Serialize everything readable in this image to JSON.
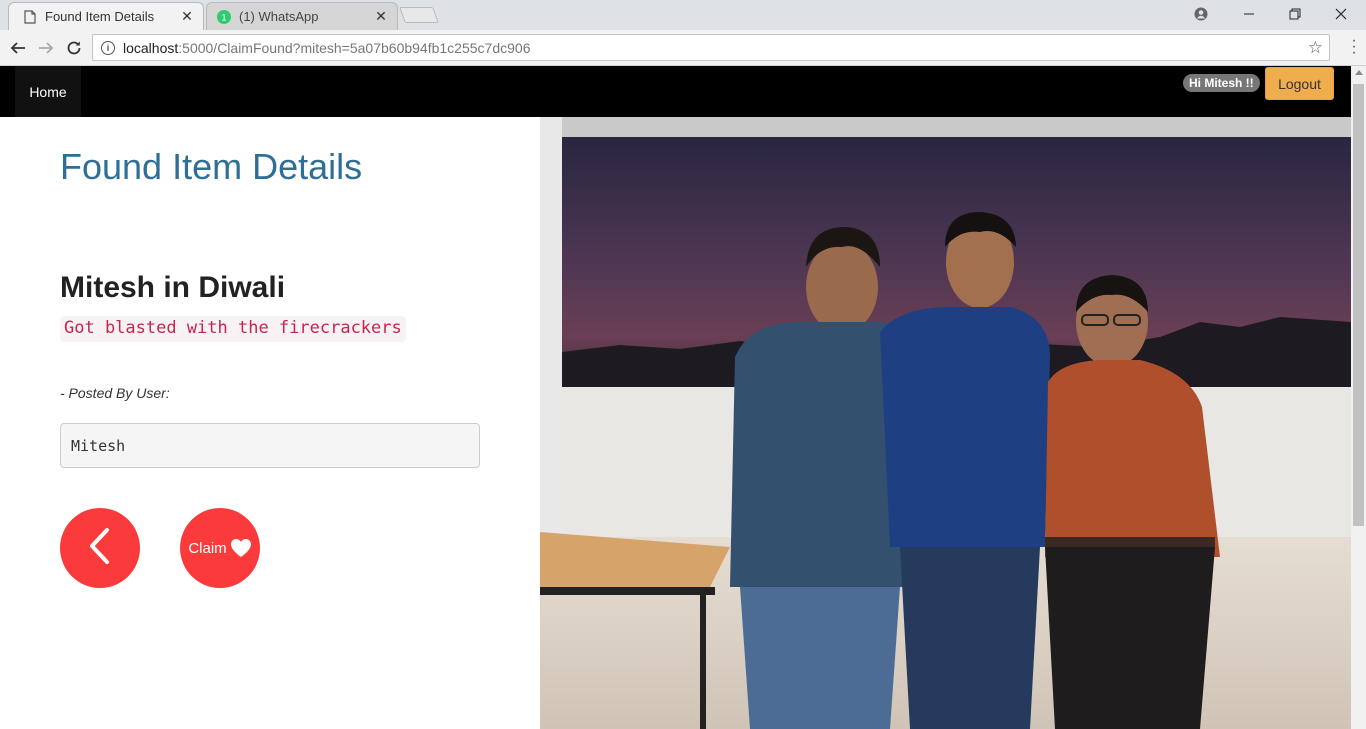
{
  "browser": {
    "tabs": [
      {
        "title": "Found Item Details",
        "active": true
      },
      {
        "title": "(1) WhatsApp",
        "badge": "1",
        "active": false
      }
    ],
    "url_host": "localhost",
    "url_path": ":5000/ClaimFound?mitesh=5a07b60b94fb1c255c7dc906"
  },
  "navbar": {
    "home_label": "Home",
    "greeting": "Hi Mitesh !!",
    "logout_label": "Logout"
  },
  "main": {
    "heading": "Found Item Details",
    "item_name": "Mitesh in Diwali",
    "item_description": "Got blasted with the firecrackers",
    "posted_by_label": "- Posted By User:",
    "posted_by_user": "Mitesh",
    "claim_label": "Claim"
  },
  "colors": {
    "accent_red": "#fb3b3b",
    "heading_blue": "#2f6f95",
    "logout_orange": "#f0ad4e"
  },
  "icons": {
    "back": "chevron-left-icon",
    "claim": "heart-icon"
  }
}
